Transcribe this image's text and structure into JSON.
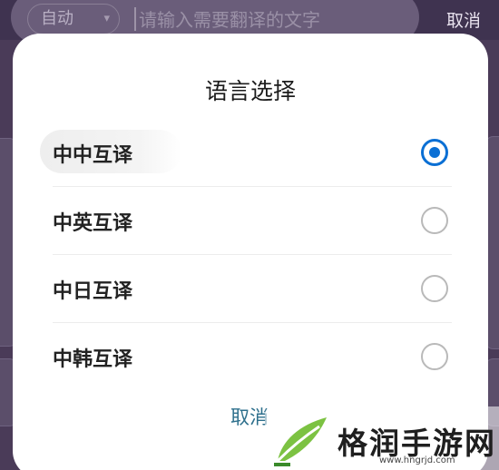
{
  "header": {
    "source_lang": "自动",
    "search_placeholder": "请输入需要翻译的文字",
    "cancel_label": "取消"
  },
  "dialog": {
    "title": "语言选择",
    "options": [
      {
        "label": "中中互译",
        "selected": true
      },
      {
        "label": "中英互译",
        "selected": false
      },
      {
        "label": "中日互译",
        "selected": false
      },
      {
        "label": "中韩互译",
        "selected": false
      }
    ],
    "cancel_label": "取消"
  },
  "watermark": {
    "brand": "格润手游网",
    "url": "www.hngrjd.com"
  },
  "colors": {
    "accent": "#0a6fd4",
    "cancel_text": "#2d6f8c",
    "backdrop": "#4a3b58"
  }
}
